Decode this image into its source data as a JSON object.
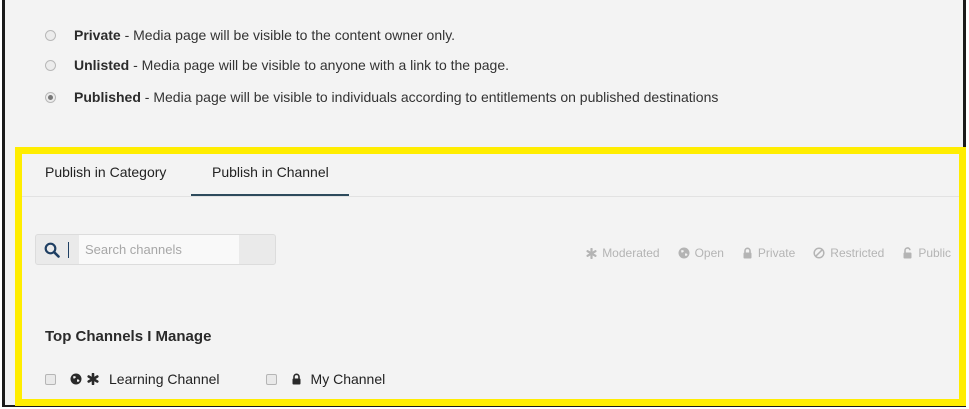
{
  "privacy_options": [
    {
      "title": "Private",
      "description": " - Media page will be visible to the content owner only.",
      "selected": false
    },
    {
      "title": "Unlisted",
      "description": " - Media page will be visible to anyone with a link to the page.",
      "selected": false
    },
    {
      "title": "Published",
      "description": " - Media page will be visible to individuals according to entitlements on published destinations",
      "selected": true
    }
  ],
  "tabs": [
    {
      "label": "Publish in Category",
      "active": false
    },
    {
      "label": "Publish in Channel",
      "active": true
    }
  ],
  "search": {
    "placeholder": "Search channels"
  },
  "legend": [
    {
      "icon": "asterisk-icon",
      "label": "Moderated"
    },
    {
      "icon": "globe-icon",
      "label": "Open"
    },
    {
      "icon": "lock-icon",
      "label": "Private"
    },
    {
      "icon": "ban-icon",
      "label": "Restricted"
    },
    {
      "icon": "unlock-icon",
      "label": "Public"
    }
  ],
  "section_title": "Top Channels I Manage",
  "channels": [
    {
      "label": "Learning Channel",
      "icons": [
        "globe-icon",
        "asterisk-icon"
      ],
      "checked": false
    },
    {
      "label": "My Channel",
      "icons": [
        "lock-icon"
      ],
      "checked": false
    }
  ],
  "colors": {
    "highlight": "#ffed00",
    "accent": "#2d4a5c",
    "search_icon": "#1f3f63"
  }
}
